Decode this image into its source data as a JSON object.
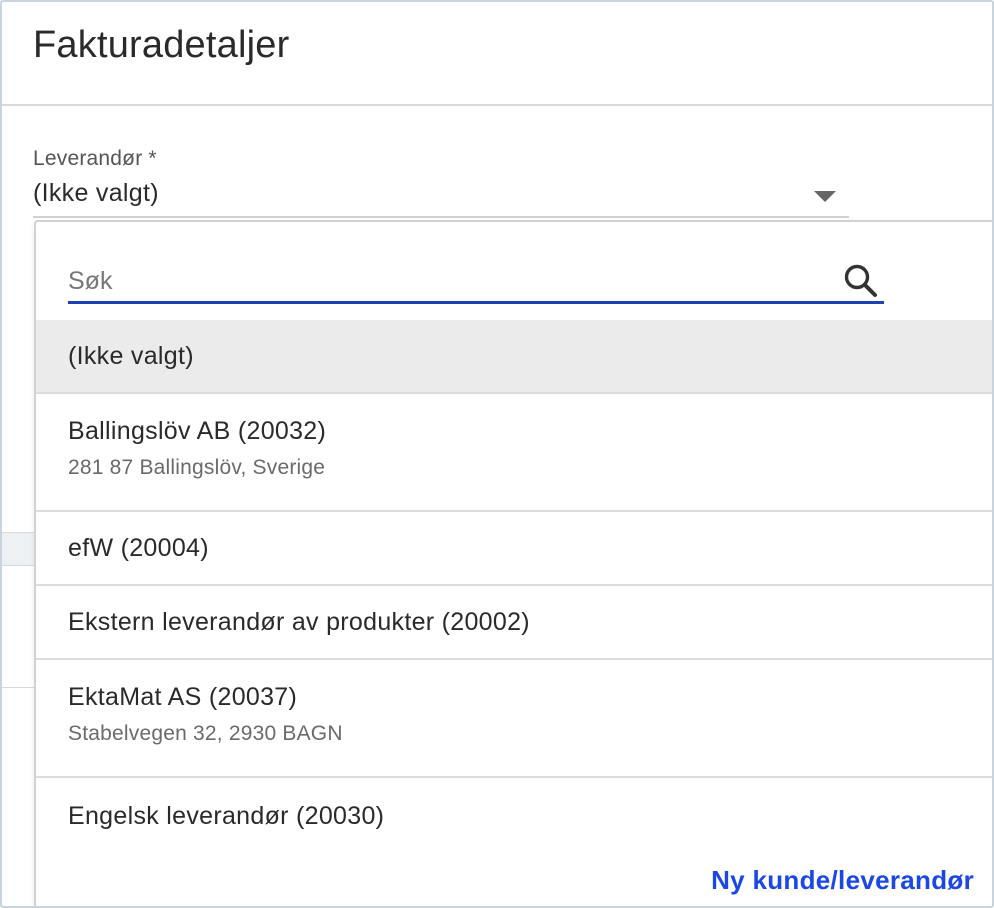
{
  "header": {
    "title": "Fakturadetaljer"
  },
  "supplier_field": {
    "label": "Leverandør *",
    "value": "(Ikke valgt)",
    "arrow_icon": "caret-down-icon"
  },
  "dropdown": {
    "search": {
      "placeholder": "Søk",
      "value": "",
      "icon": "search-icon"
    },
    "options": [
      {
        "title": "(Ikke valgt)",
        "subtitle": "",
        "selected": true
      },
      {
        "title": "Ballingslöv AB (20032)",
        "subtitle": "281 87 Ballingslöv, Sverige",
        "selected": false
      },
      {
        "title": "efW (20004)",
        "subtitle": "",
        "selected": false
      },
      {
        "title": "Ekstern leverandør av produkter (20002)",
        "subtitle": "",
        "selected": false
      },
      {
        "title": "EktaMat AS (20037)",
        "subtitle": "Stabelvegen 32, 2930 BAGN",
        "selected": false
      },
      {
        "title": "Engelsk leverandør (20030)",
        "subtitle": "",
        "selected": false
      }
    ],
    "new_link": "Ny kunde/leverandør"
  },
  "colors": {
    "accent": "#1f3fb4",
    "link": "#1a47e6",
    "selected_bg": "#ebebeb"
  }
}
